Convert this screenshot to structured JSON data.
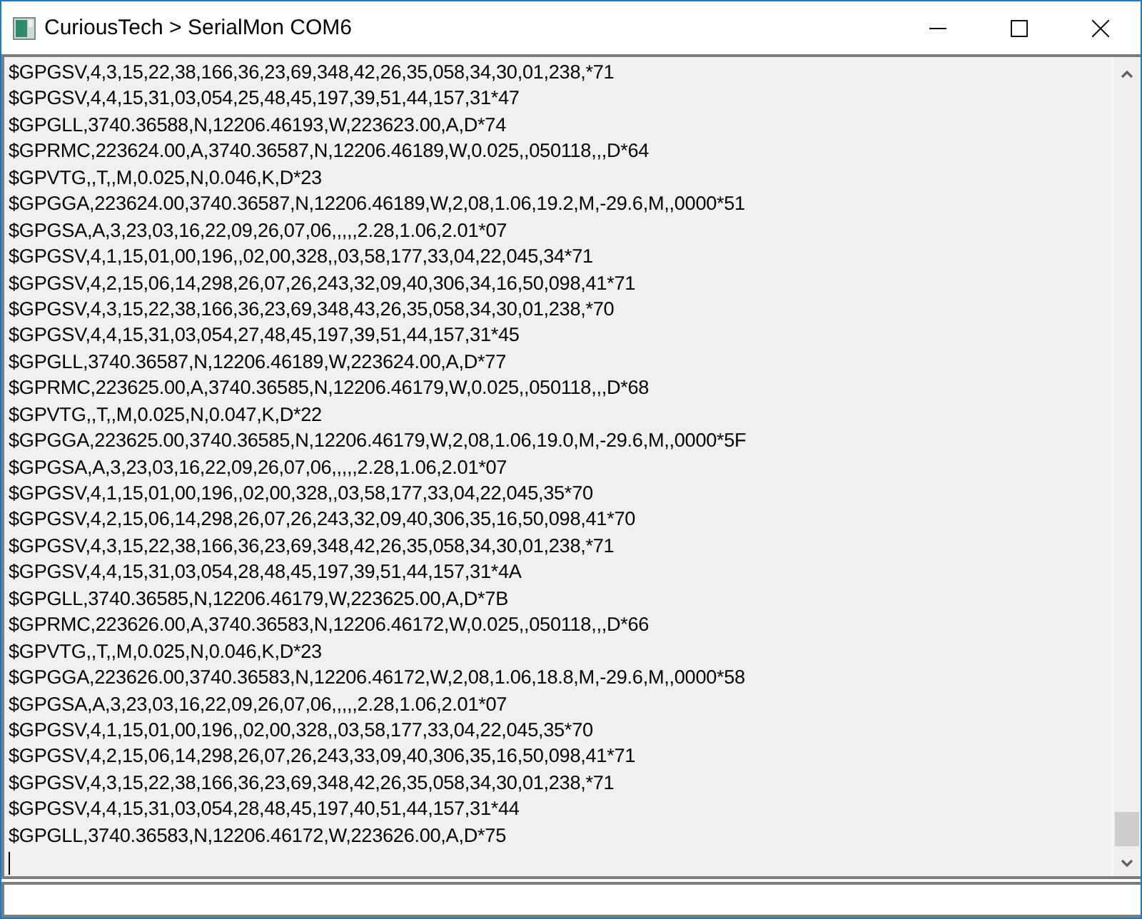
{
  "window": {
    "title": "CuriousTech > SerialMon COM6"
  },
  "output": {
    "lines": [
      "$GPGSV,4,3,15,22,38,166,36,23,69,348,42,26,35,058,34,30,01,238,*71",
      "$GPGSV,4,4,15,31,03,054,25,48,45,197,39,51,44,157,31*47",
      "$GPGLL,3740.36588,N,12206.46193,W,223623.00,A,D*74",
      "$GPRMC,223624.00,A,3740.36587,N,12206.46189,W,0.025,,050118,,,D*64",
      "$GPVTG,,T,,M,0.025,N,0.046,K,D*23",
      "$GPGGA,223624.00,3740.36587,N,12206.46189,W,2,08,1.06,19.2,M,-29.6,M,,0000*51",
      "$GPGSA,A,3,23,03,16,22,09,26,07,06,,,,,2.28,1.06,2.01*07",
      "$GPGSV,4,1,15,01,00,196,,02,00,328,,03,58,177,33,04,22,045,34*71",
      "$GPGSV,4,2,15,06,14,298,26,07,26,243,32,09,40,306,34,16,50,098,41*71",
      "$GPGSV,4,3,15,22,38,166,36,23,69,348,43,26,35,058,34,30,01,238,*70",
      "$GPGSV,4,4,15,31,03,054,27,48,45,197,39,51,44,157,31*45",
      "$GPGLL,3740.36587,N,12206.46189,W,223624.00,A,D*77",
      "$GPRMC,223625.00,A,3740.36585,N,12206.46179,W,0.025,,050118,,,D*68",
      "$GPVTG,,T,,M,0.025,N,0.047,K,D*22",
      "$GPGGA,223625.00,3740.36585,N,12206.46179,W,2,08,1.06,19.0,M,-29.6,M,,0000*5F",
      "$GPGSA,A,3,23,03,16,22,09,26,07,06,,,,,2.28,1.06,2.01*07",
      "$GPGSV,4,1,15,01,00,196,,02,00,328,,03,58,177,33,04,22,045,35*70",
      "$GPGSV,4,2,15,06,14,298,26,07,26,243,32,09,40,306,35,16,50,098,41*70",
      "$GPGSV,4,3,15,22,38,166,36,23,69,348,42,26,35,058,34,30,01,238,*71",
      "$GPGSV,4,4,15,31,03,054,28,48,45,197,39,51,44,157,31*4A",
      "$GPGLL,3740.36585,N,12206.46179,W,223625.00,A,D*7B",
      "$GPRMC,223626.00,A,3740.36583,N,12206.46172,W,0.025,,050118,,,D*66",
      "$GPVTG,,T,,M,0.025,N,0.046,K,D*23",
      "$GPGGA,223626.00,3740.36583,N,12206.46172,W,2,08,1.06,18.8,M,-29.6,M,,0000*58",
      "$GPGSA,A,3,23,03,16,22,09,26,07,06,,,,,2.28,1.06,2.01*07",
      "$GPGSV,4,1,15,01,00,196,,02,00,328,,03,58,177,33,04,22,045,35*70",
      "$GPGSV,4,2,15,06,14,298,26,07,26,243,33,09,40,306,35,16,50,098,41*71",
      "$GPGSV,4,3,15,22,38,166,36,23,69,348,42,26,35,058,34,30,01,238,*71",
      "$GPGSV,4,4,15,31,03,054,28,48,45,197,40,51,44,157,31*44",
      "$GPGLL,3740.36583,N,12206.46172,W,223626.00,A,D*75"
    ]
  }
}
